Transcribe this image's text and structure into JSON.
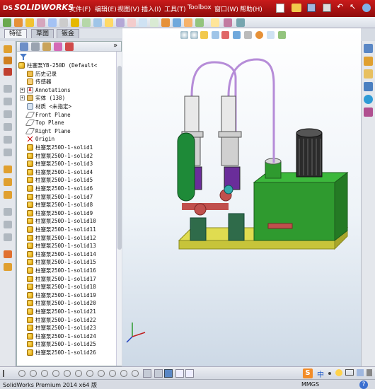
{
  "app": {
    "logo_prefix": "DS",
    "logo": "SOLIDWORKS"
  },
  "menu": [
    "文件(F)",
    "编辑(E)",
    "视图(V)",
    "插入(I)",
    "工具(T)",
    "Toolbox",
    "窗口(W)",
    "帮助(H)"
  ],
  "tabs": [
    "特征",
    "草图",
    "钣金"
  ],
  "tree": {
    "root": "柱塞泵YB-250D  (Default<",
    "history": "历史记录",
    "sensors": "传感器",
    "annotations": "Annotations",
    "solids": "实体 (138)",
    "material": "材质 <未指定>",
    "front": "Front Plane",
    "top": "Top Plane",
    "right": "Right Plane",
    "origin": "Origin",
    "bodies": [
      "柱塞泵250D-1-solid1",
      "柱塞泵250D-1-solid2",
      "柱塞泵250D-1-solid3",
      "柱塞泵250D-1-solid4",
      "柱塞泵250D-1-solid5",
      "柱塞泵250D-1-solid6",
      "柱塞泵250D-1-solid7",
      "柱塞泵250D-1-solid8",
      "柱塞泵250D-1-solid9",
      "柱塞泵250D-1-solid10",
      "柱塞泵250D-1-solid11",
      "柱塞泵250D-1-solid12",
      "柱塞泵250D-1-solid13",
      "柱塞泵250D-1-solid14",
      "柱塞泵250D-1-solid15",
      "柱塞泵250D-1-solid16",
      "柱塞泵250D-1-solid17",
      "柱塞泵250D-1-solid18",
      "柱塞泵250D-1-solid19",
      "柱塞泵250D-1-solid20",
      "柱塞泵250D-1-solid21",
      "柱塞泵250D-1-solid22",
      "柱塞泵250D-1-solid23",
      "柱塞泵250D-1-solid24",
      "柱塞泵250D-1-solid25",
      "柱塞泵250D-1-solid26"
    ]
  },
  "status": {
    "left": "SolidWorks Premium 2014 x64 版",
    "units": "MMGS",
    "help": "?"
  },
  "ime": {
    "lang": "中"
  },
  "colors": {
    "title": "#b01515",
    "accent": "#2a6fd0",
    "motor_green": "#2f9a2f",
    "base_yellow": "#d7d44a"
  }
}
